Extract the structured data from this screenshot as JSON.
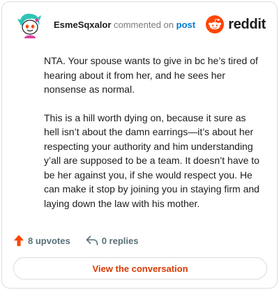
{
  "header": {
    "username": "EsmeSqxalor",
    "action_text": "commented on",
    "target_link": "post",
    "brand_name": "reddit"
  },
  "comment": {
    "paragraphs": [
      "NTA. Your spouse wants to give in bc he’s tired of hearing about it from her, and he sees her nonsense as normal.",
      "This is a hill worth dying on, because it sure as hell isn’t about the damn earrings—it’s about her respecting your authority and him understanding y’all are supposed to be a team. It doesn’t have to be her against you, if she would respect you. He can make it stop by joining you in staying firm and laying down the law with his mother."
    ]
  },
  "actions": {
    "upvotes_label": "8 upvotes",
    "replies_label": "0 replies"
  },
  "footer": {
    "view_button_label": "View the conversation"
  },
  "colors": {
    "brand_orange": "#ff4500",
    "link_blue": "#0079d3",
    "button_text": "#d93900",
    "meta_gray": "#7c7c7c"
  },
  "icons": {
    "avatar": "snoo-avatar-teal-hair",
    "brand_logo": "reddit-snoo-icon",
    "upvote": "arrow-up-icon",
    "reply": "reply-arrow-icon"
  }
}
